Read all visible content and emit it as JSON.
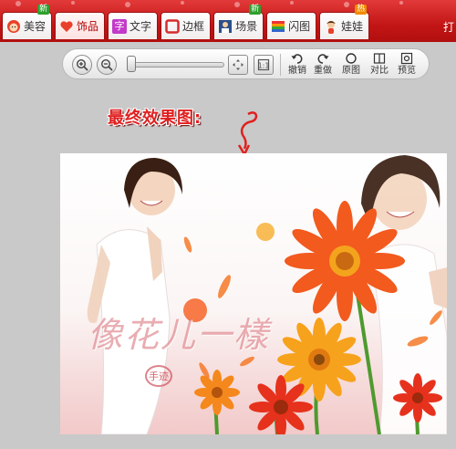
{
  "tabs": [
    {
      "label": "美容",
      "badge": "新",
      "badge_color": "#2e9e2e",
      "icon": "face-icon",
      "active": false
    },
    {
      "label": "饰品",
      "badge": "",
      "icon": "heart-icon",
      "active": true
    },
    {
      "label": "文字",
      "badge": "",
      "icon": "text-char-icon",
      "active": false
    },
    {
      "label": "边框",
      "badge": "",
      "icon": "frame-icon",
      "active": false
    },
    {
      "label": "场景",
      "badge": "新",
      "badge_color": "#2e9e2e",
      "icon": "scene-icon",
      "active": false
    },
    {
      "label": "闪图",
      "badge": "",
      "icon": "flash-icon",
      "active": false
    },
    {
      "label": "娃娃",
      "badge": "热",
      "badge_color": "#f08a00",
      "icon": "doll-icon",
      "active": false
    }
  ],
  "text_icon_glyph": "字",
  "right_label": "打",
  "toolbar": {
    "zoom_in_icon": "zoom-in-icon",
    "zoom_out_icon": "zoom-out-icon",
    "zoom_slider_value": 0.0,
    "fit_icon": "fit-window-icon",
    "actual_size_icon": "actual-size-icon",
    "tools": [
      {
        "label": "撤销",
        "icon": "undo-icon"
      },
      {
        "label": "重做",
        "icon": "redo-icon"
      },
      {
        "label": "原图",
        "icon": "original-icon"
      },
      {
        "label": "对比",
        "icon": "compare-icon"
      },
      {
        "label": "预览",
        "icon": "preview-icon"
      }
    ]
  },
  "annotation": "最终效果图:",
  "result_image": {
    "calligraphy": "像花儿一樣",
    "seal": "手迹"
  },
  "colors": {
    "brand_red": "#c31515",
    "annotation_red": "#e02020",
    "flower_orange": "#f25a1e"
  }
}
